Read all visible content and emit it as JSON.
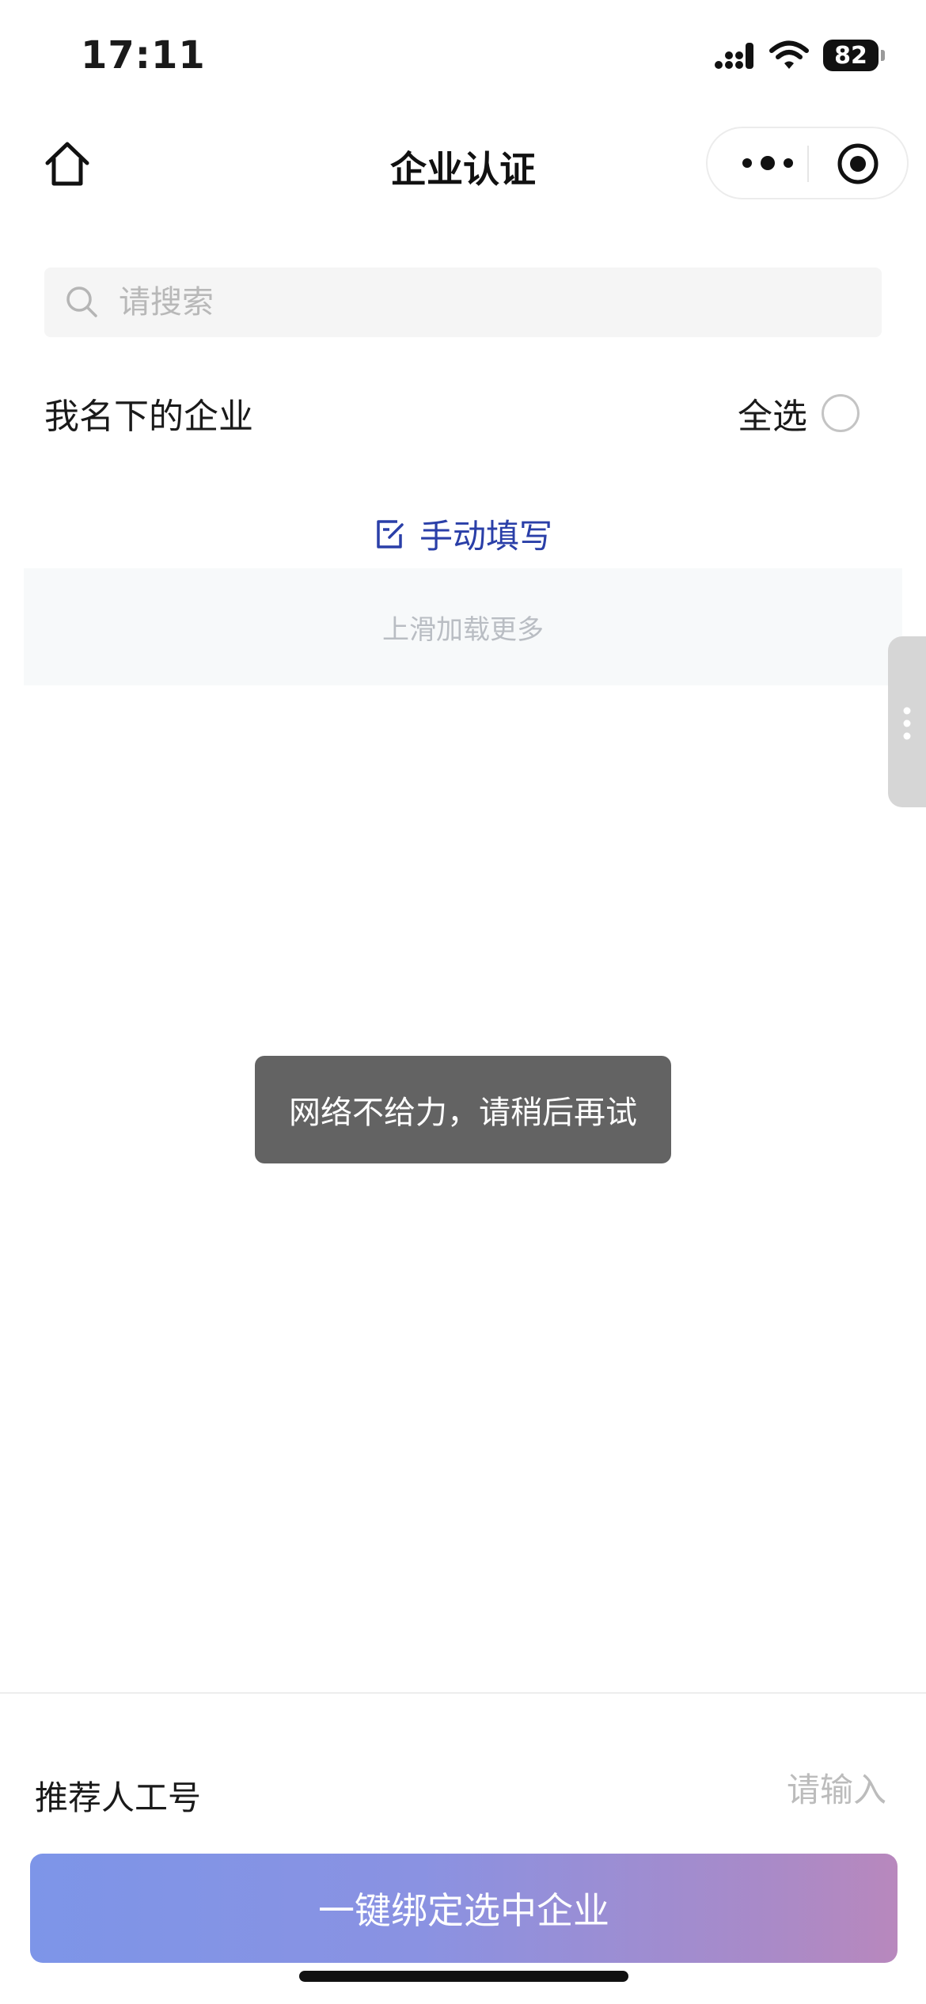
{
  "status_bar": {
    "time": "17:11",
    "battery_level": "82",
    "icons": [
      "cellular-signal-icon",
      "wifi-icon",
      "battery-icon"
    ]
  },
  "nav": {
    "title": "企业认证",
    "icons": [
      "home-icon",
      "more-dots-icon",
      "close-miniprogram-icon"
    ]
  },
  "search": {
    "placeholder": "请搜索",
    "value": "",
    "icon": "search-icon"
  },
  "companies": {
    "section_title": "我名下的企业",
    "select_all_label": "全选",
    "select_all_checked": false
  },
  "manual_fill": {
    "label": "手动填写",
    "icon": "edit-icon"
  },
  "list": {
    "load_more_text": "上滑加载更多"
  },
  "toast": {
    "message": "网络不给力，请稍后再试"
  },
  "referrer": {
    "label": "推荐人工号",
    "placeholder": "请输入",
    "value": ""
  },
  "actions": {
    "bind_label": "一键绑定选中企业"
  },
  "colors": {
    "accent_blue": "#2a3fa8",
    "toast_bg": "#636363",
    "button_gradient_start": "#7d95e8",
    "button_gradient_end": "#b888bd"
  }
}
